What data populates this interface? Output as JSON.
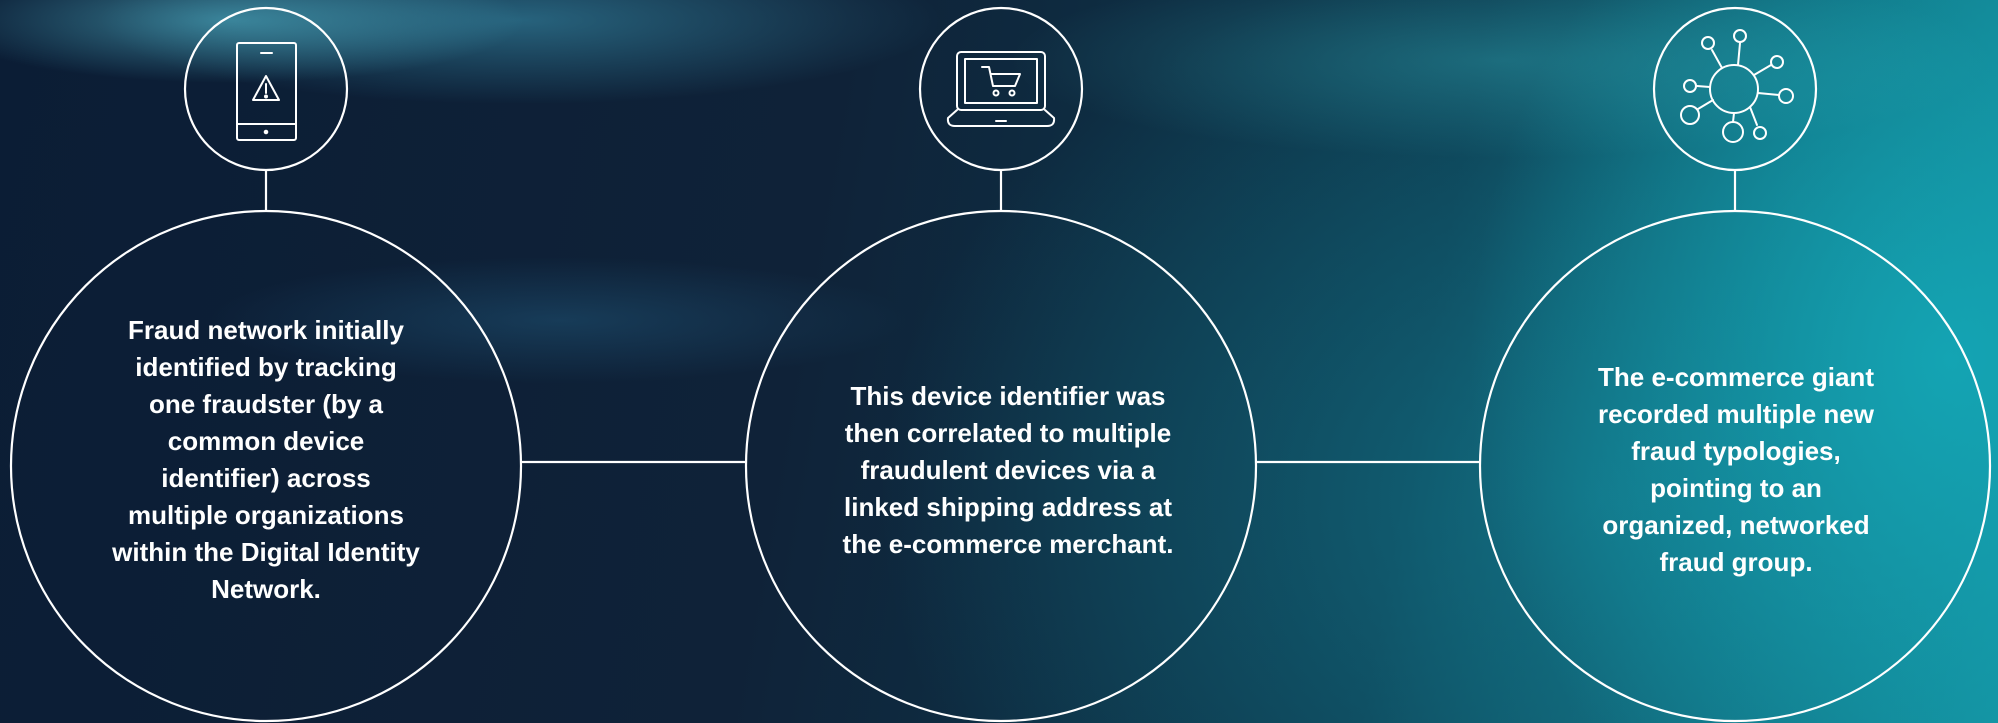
{
  "steps": [
    {
      "icon": "mobile-warning-icon",
      "text": "Fraud network initially identified by tracking one fraudster (by a common device identifier) across multiple organizations within the Digital Identity Network."
    },
    {
      "icon": "laptop-cart-icon",
      "text": "This device identifier was then correlated to multiple fraudulent devices via a linked shipping address at the e-commerce merchant."
    },
    {
      "icon": "network-hub-icon",
      "text": "The e-commerce giant recorded multiple new fraud typologies, pointing to an organized, networked fraud group."
    }
  ]
}
